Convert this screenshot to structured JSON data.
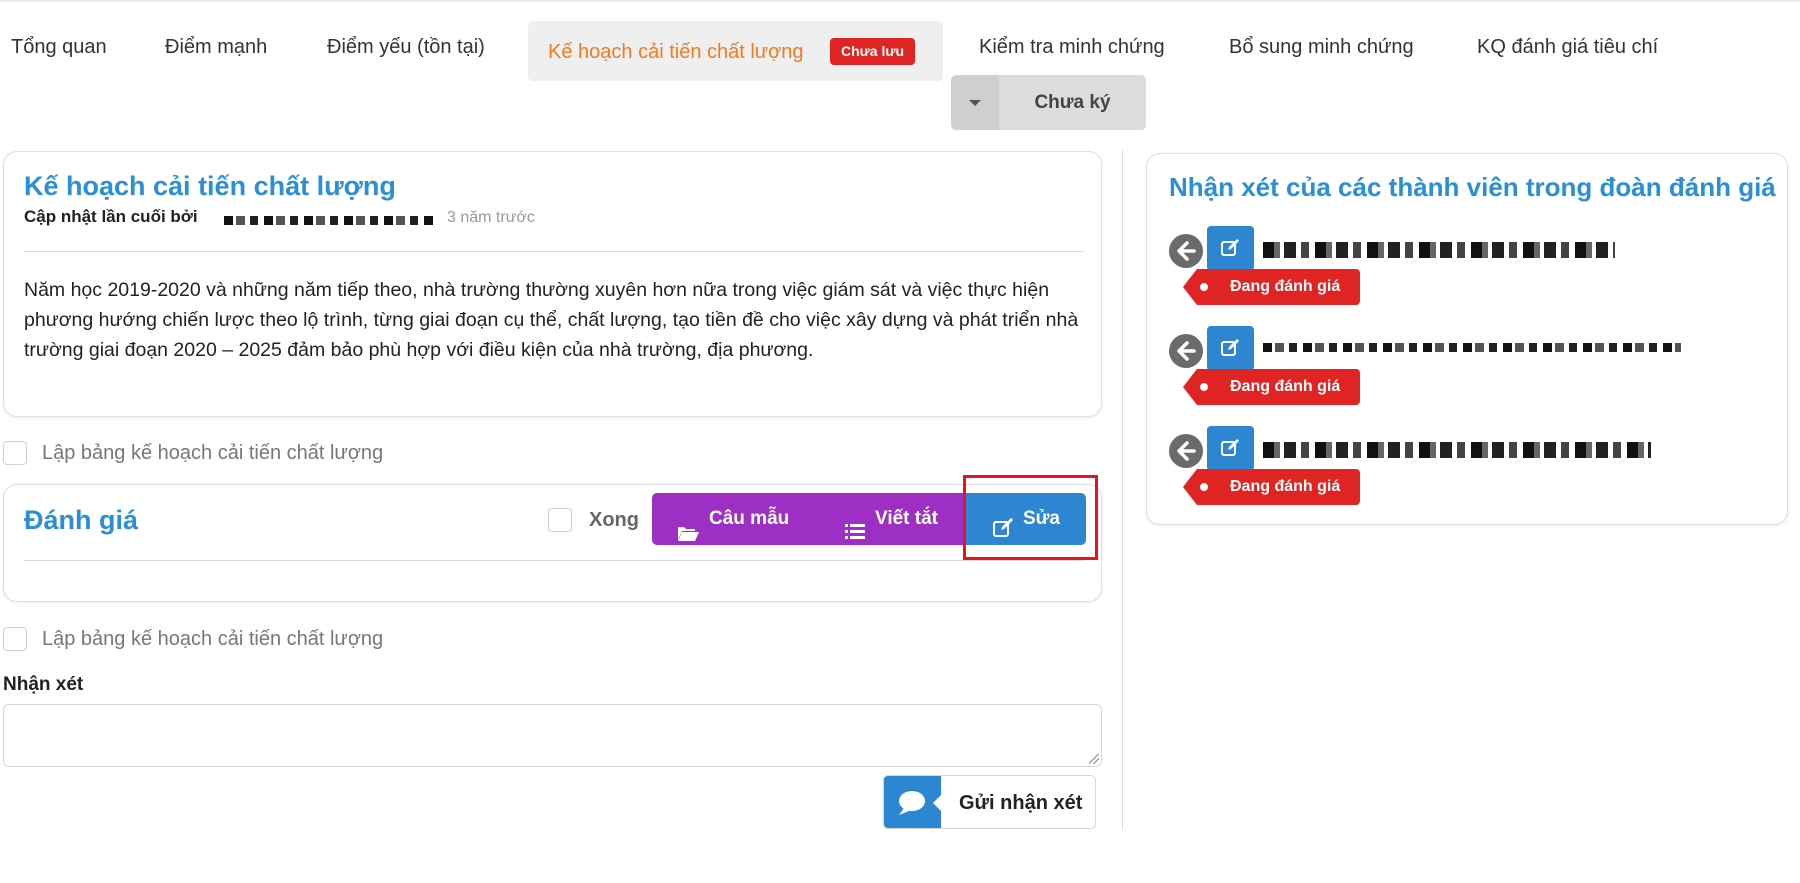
{
  "tabs": {
    "overview": "Tổng quan",
    "strengths": "Điểm mạnh",
    "weaknesses": "Điểm yếu (tồn tại)",
    "plan": "Kế hoạch cải tiến chất lượng",
    "plan_badge": "Chưa lưu",
    "check_evidence": "Kiểm tra minh chứng",
    "add_evidence": "Bổ sung minh chứng",
    "criteria_result": "KQ đánh giá tiêu chí"
  },
  "sign_status": "Chưa ký",
  "plan_card": {
    "title": "Kế hoạch cải tiến chất lượng",
    "updated_by_label": "Cập nhật lần cuối bởi",
    "updated_ago": "3 năm trước",
    "body": "Năm học 2019-2020 và những năm tiếp theo, nhà trường thường xuyên hơn nữa trong việc giám sát và việc thực hiện phương hướng chiến lược theo lộ trình, từng giai đoạn cụ thể, chất lượng, tạo tiền đề cho việc xây dựng và phát triển nhà trường giai đoạn 2020 – 2025 đảm bảo phù hợp với điều kiện của nhà trường, địa phương."
  },
  "checkbox_plan_label": "Lập bảng kế hoạch cải tiến chất lượng",
  "evaluation": {
    "title": "Đánh giá",
    "done_label": "Xong",
    "sample_button": "Câu mẫu",
    "abbrev_button": "Viết tắt",
    "edit_button": "Sửa"
  },
  "comment": {
    "label": "Nhận xét",
    "send_button": "Gửi nhận xét"
  },
  "reviews": {
    "title": "Nhận xét của các thành viên trong đoàn đánh giá",
    "status_label": "Đang đánh giá"
  },
  "colors": {
    "accent_blue": "#2a8fd4",
    "active_tab_orange": "#f27a1f",
    "badge_red": "#e02424",
    "purple": "#9d2fc4"
  }
}
